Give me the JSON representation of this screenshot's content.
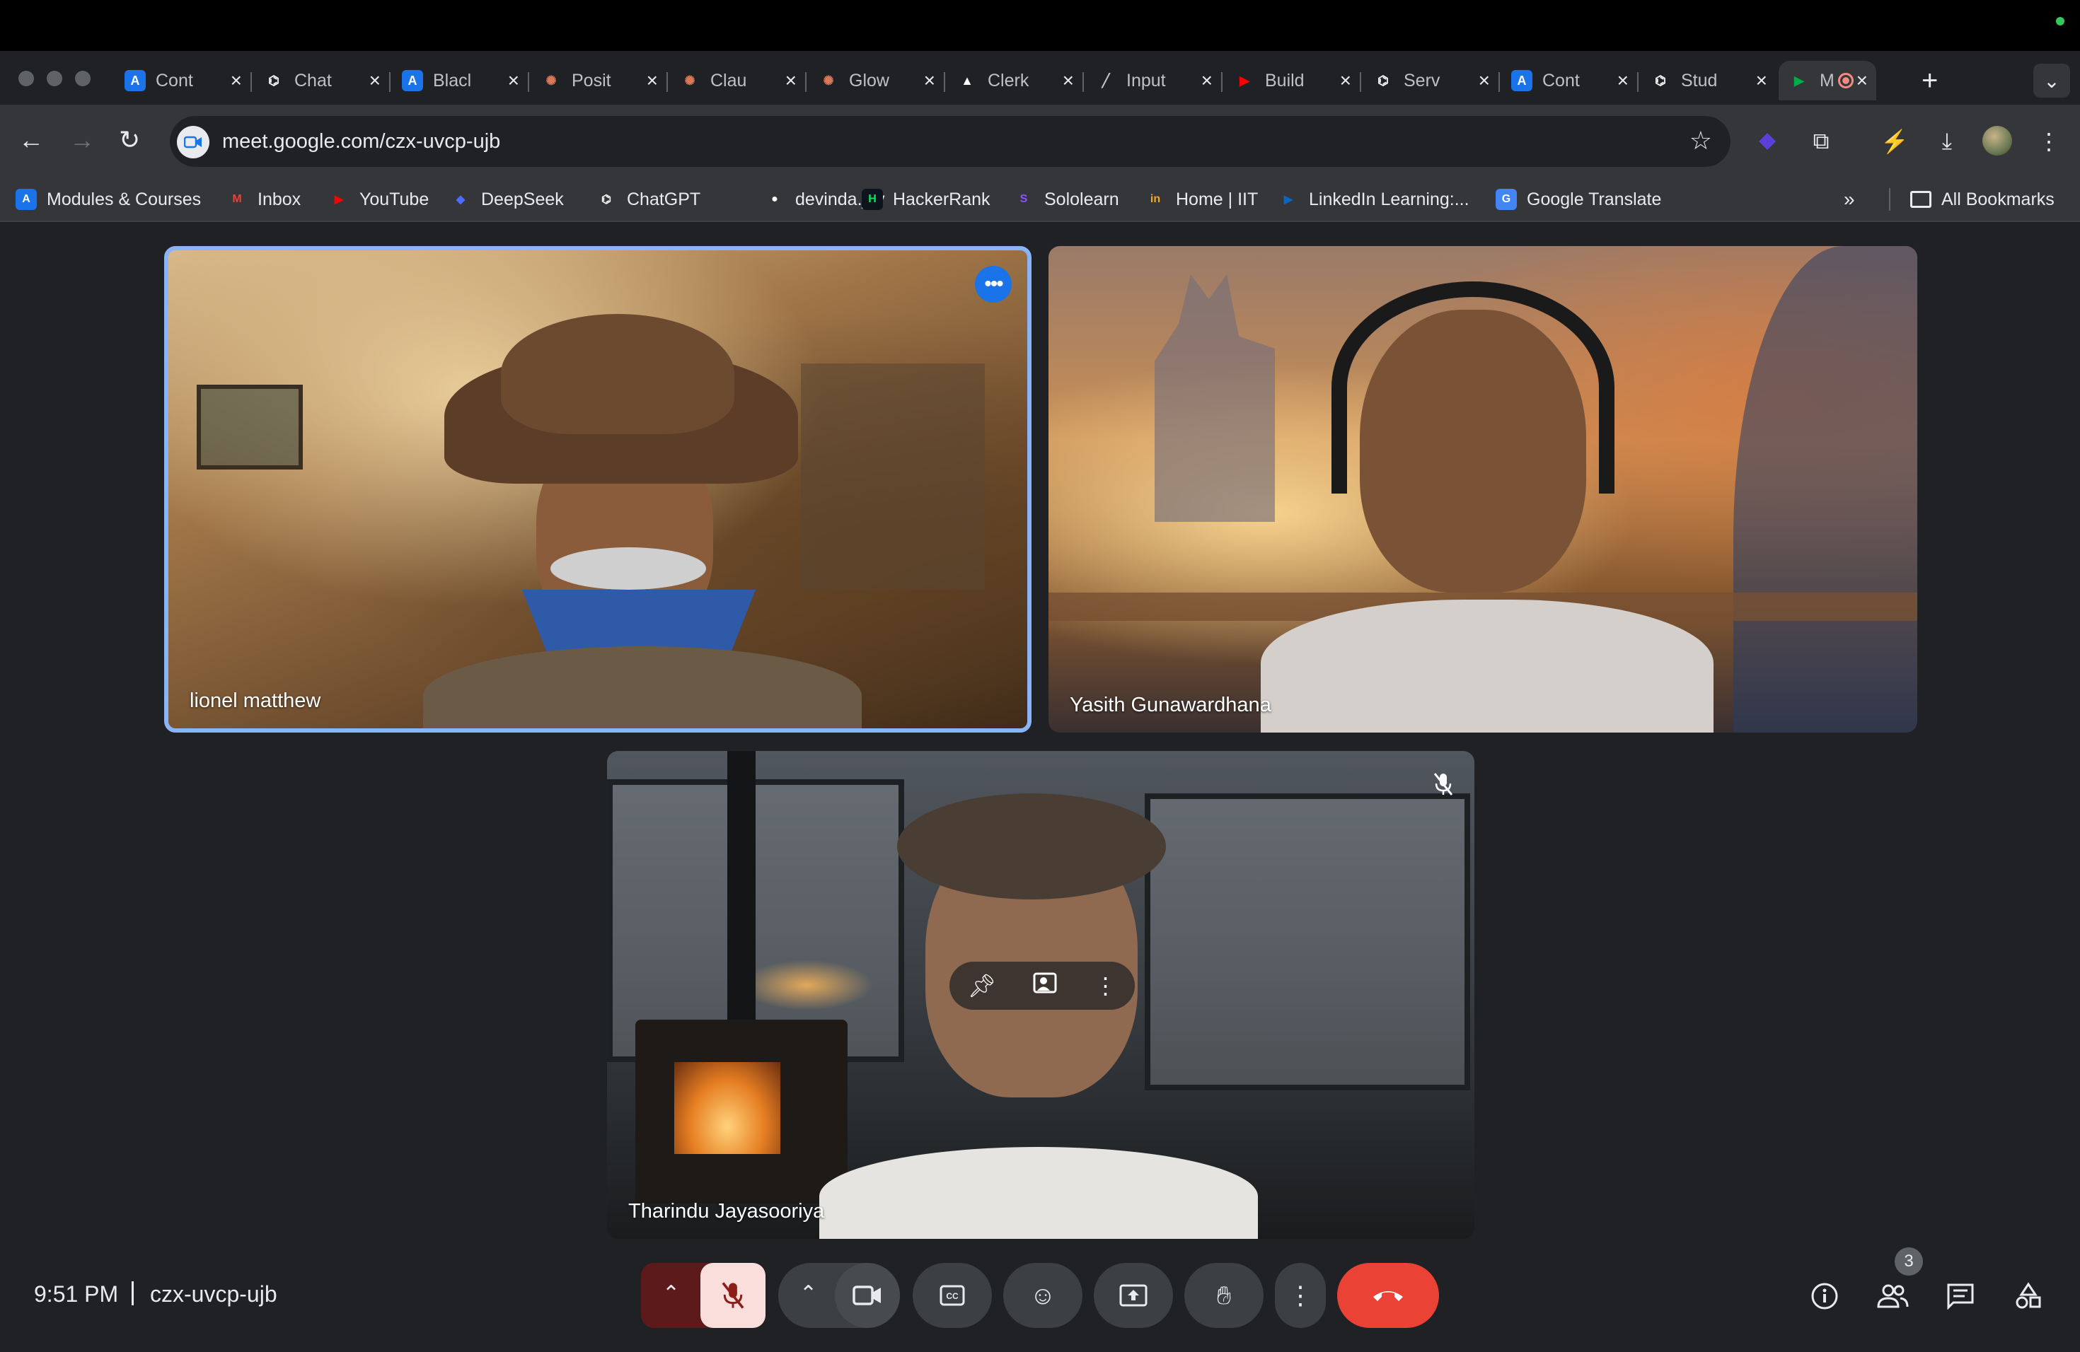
{
  "browser": {
    "tabs": [
      {
        "title": "Cont",
        "favicon": "A",
        "favicon_color": "#1a73e8"
      },
      {
        "title": "Chat",
        "favicon": "⌬",
        "favicon_color": "#ffffff"
      },
      {
        "title": "Blacl",
        "favicon": "A",
        "favicon_color": "#1a73e8"
      },
      {
        "title": "Posit",
        "favicon": "✺",
        "favicon_color": "#d97757"
      },
      {
        "title": "Clau",
        "favicon": "✺",
        "favicon_color": "#d97757"
      },
      {
        "title": "Glow",
        "favicon": "✺",
        "favicon_color": "#d97757"
      },
      {
        "title": "Clerk",
        "favicon": "▲",
        "favicon_color": "#ffffff"
      },
      {
        "title": "Input",
        "favicon": "╱",
        "favicon_color": "#bdc1c6"
      },
      {
        "title": "Build",
        "favicon": "▶",
        "favicon_color": "#ff0000"
      },
      {
        "title": "Serv",
        "favicon": "⌬",
        "favicon_color": "#ffffff"
      },
      {
        "title": "Cont",
        "favicon": "A",
        "favicon_color": "#1a73e8"
      },
      {
        "title": "Stud",
        "favicon": "⌬",
        "favicon_color": "#ffffff"
      },
      {
        "title": "M",
        "favicon": "▶",
        "favicon_color": "#00ac47",
        "active": true
      }
    ],
    "new_tab_icon": "+",
    "url": "meet.google.com/czx-uvcp-ujb"
  },
  "bookmarks": [
    {
      "label": "Modules & Courses",
      "icon": "A",
      "color": "#1a73e8"
    },
    {
      "label": "Inbox",
      "icon": "M",
      "color": "#ea4335"
    },
    {
      "label": "YouTube",
      "icon": "▶",
      "color": "#ff0000"
    },
    {
      "label": "DeepSeek",
      "icon": "◆",
      "color": "#4d6bfe"
    },
    {
      "label": "ChatGPT",
      "icon": "⌬",
      "color": "#ffffff"
    },
    {
      "label": "devinda.jay",
      "icon": "●",
      "color": "#ffffff"
    },
    {
      "label": "HackerRank",
      "icon": "H",
      "color": "#00ea64"
    },
    {
      "label": "Sololearn",
      "icon": "S",
      "color": "#8c52ff"
    },
    {
      "label": "Home | IIT",
      "icon": "in",
      "color": "#f5a623"
    },
    {
      "label": "LinkedIn Learning:...",
      "icon": "▶",
      "color": "#0a66c2"
    },
    {
      "label": "Google Translate",
      "icon": "G",
      "color": "#4285f4"
    }
  ],
  "bookmarks_all": "All Bookmarks",
  "meet": {
    "participants": [
      {
        "name": "lionel matthew"
      },
      {
        "name": "Yasith Gunawardhana"
      },
      {
        "name": "Tharindu Jayasooriya"
      }
    ],
    "time": "9:51 PM",
    "meeting_code": "czx-uvcp-ujb",
    "people_count": "3",
    "accent_color": "#8ab4f8",
    "end_call_color": "#ea4335"
  }
}
